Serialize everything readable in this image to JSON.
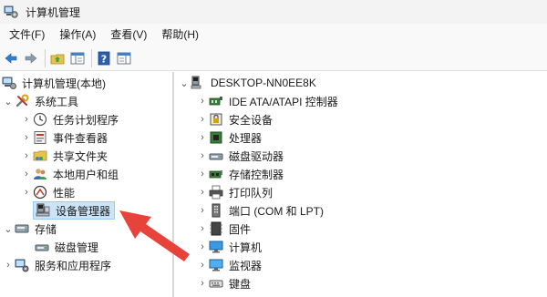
{
  "window": {
    "title": "计算机管理"
  },
  "menu": {
    "file": "文件(F)",
    "action": "操作(A)",
    "view": "查看(V)",
    "help": "帮助(H)"
  },
  "toolbar": {
    "back_icon": "arrow-left-icon",
    "forward_icon": "arrow-right-icon",
    "up_icon": "folder-up-icon",
    "console_tree_icon": "console-tree-icon",
    "help_icon": "help-icon",
    "show_pane_icon": "show-pane-icon"
  },
  "tree": {
    "root": "计算机管理(本地)",
    "system_tools": "系统工具",
    "task_scheduler": "任务计划程序",
    "event_viewer": "事件查看器",
    "shared_folders": "共享文件夹",
    "local_users": "本地用户和组",
    "performance": "性能",
    "device_manager": "设备管理器",
    "storage": "存储",
    "disk_management": "磁盘管理",
    "services_apps": "服务和应用程序"
  },
  "devices": {
    "computer_name": "DESKTOP-NN0EE8K",
    "items": [
      "IDE ATA/ATAPI 控制器",
      "安全设备",
      "处理器",
      "磁盘驱动器",
      "存储控制器",
      "打印队列",
      "端口 (COM 和 LPT)",
      "固件",
      "计算机",
      "监视器",
      "键盘"
    ]
  },
  "colors": {
    "selection": "#cce4f7",
    "arrow": "#e8433a"
  }
}
